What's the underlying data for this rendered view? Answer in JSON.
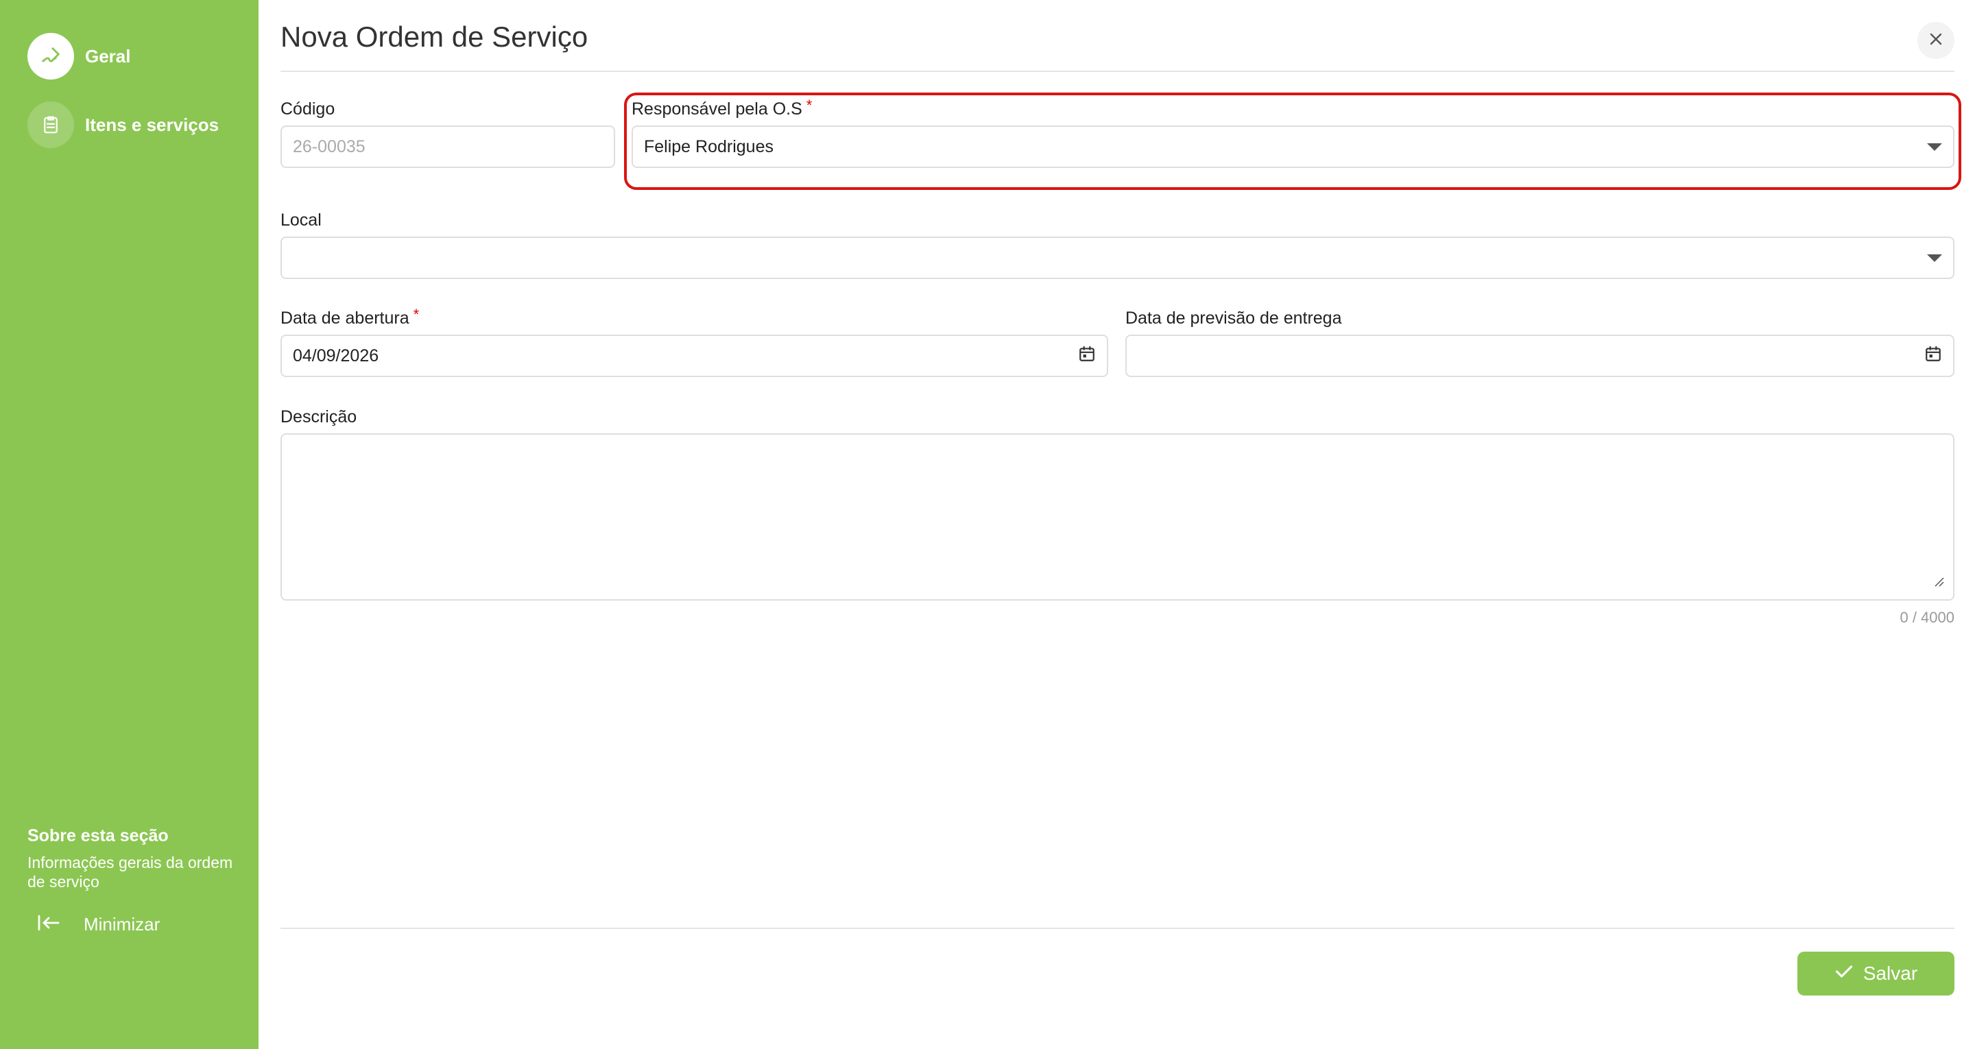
{
  "sidebar": {
    "items": [
      {
        "label": "Geral",
        "icon": "pen-icon",
        "active": true
      },
      {
        "label": "Itens e serviços",
        "icon": "clipboard-icon",
        "active": false
      }
    ],
    "about": {
      "title": "Sobre esta seção",
      "text": "Informações gerais da ordem de serviço"
    },
    "minimize_label": "Minimizar"
  },
  "header": {
    "title": "Nova Ordem de Serviço"
  },
  "form": {
    "codigo": {
      "label": "Código",
      "placeholder": "26-00035"
    },
    "responsavel": {
      "label": "Responsável pela O.S",
      "required": "*",
      "value": "Felipe Rodrigues"
    },
    "local": {
      "label": "Local",
      "value": ""
    },
    "data_abertura": {
      "label": "Data de abertura",
      "required": "*",
      "value": "04/09/2026"
    },
    "data_previsao": {
      "label": "Data de previsão de entrega",
      "value": ""
    },
    "descricao": {
      "label": "Descrição",
      "value": "",
      "counter": "0 / 4000"
    }
  },
  "footer": {
    "save_label": "Salvar"
  },
  "colors": {
    "accent": "#8bc652",
    "highlight": "#d91515",
    "required": "#e00000"
  }
}
